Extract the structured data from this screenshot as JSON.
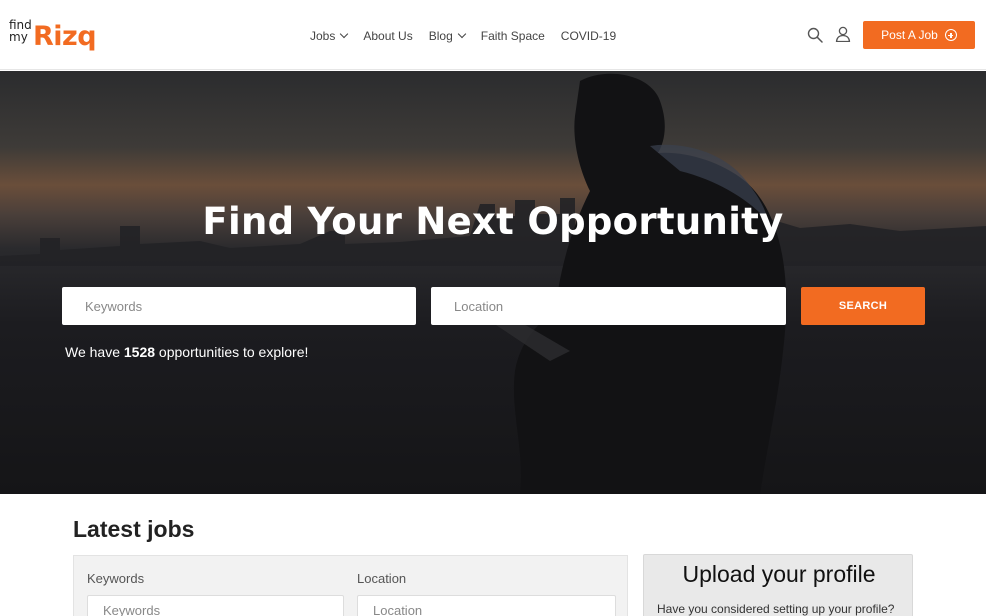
{
  "header": {
    "logo": {
      "line1": "find",
      "line2": "my",
      "brand": "Rizq"
    },
    "nav": [
      {
        "label": "Jobs",
        "dropdown": true
      },
      {
        "label": "About Us",
        "dropdown": false
      },
      {
        "label": "Blog",
        "dropdown": true
      },
      {
        "label": "Faith Space",
        "dropdown": false
      },
      {
        "label": "COVID-19",
        "dropdown": false
      }
    ],
    "search_icon": "search-icon",
    "user_icon": "user-icon",
    "post_job_label": "Post A Job",
    "post_job_icon": "plus-circle-icon"
  },
  "hero": {
    "title": "Find Your Next Opportunity",
    "keywords_placeholder": "Keywords",
    "location_placeholder": "Location",
    "search_label": "SEARCH",
    "count_prefix": "We have ",
    "count": "1528",
    "count_suffix": " opportunities to explore!"
  },
  "latest": {
    "title": "Latest jobs",
    "keywords_label": "Keywords",
    "keywords_placeholder": "Keywords",
    "location_label": "Location",
    "location_placeholder": "Location"
  },
  "upload": {
    "title": "Upload your profile",
    "text": "Have you considered setting up your profile?"
  },
  "colors": {
    "accent": "#f26b21",
    "header_bg": "#ffffff",
    "hero_overlay": "#1c1c20"
  }
}
